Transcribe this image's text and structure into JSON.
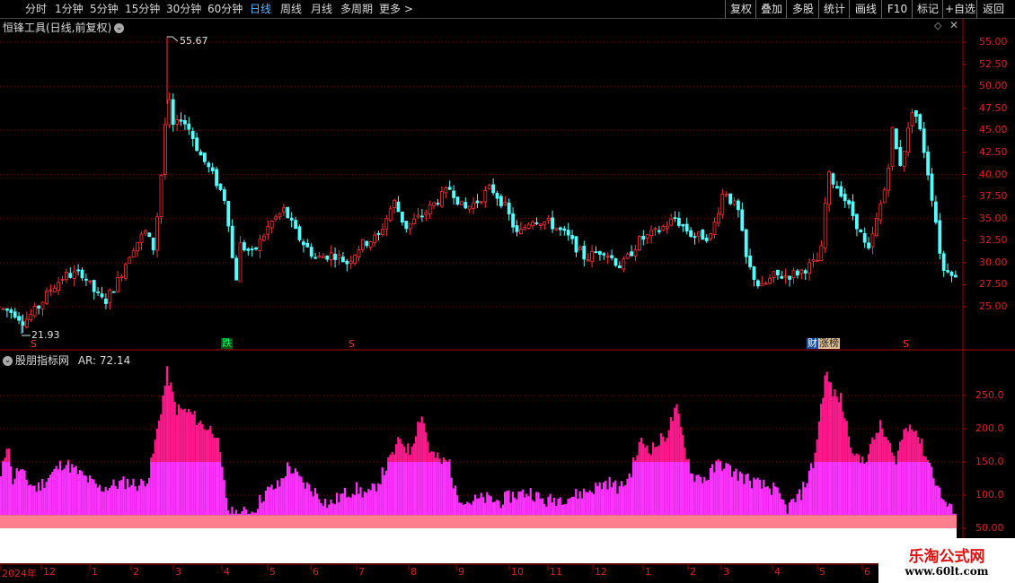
{
  "toolbar": {
    "periods": [
      "分时",
      "1分钟",
      "5分钟",
      "15分钟",
      "30分钟",
      "60分钟",
      "日线",
      "周线",
      "月线",
      "多周期",
      "更多 >"
    ],
    "active_period": "日线",
    "right_buttons": [
      "复权",
      "叠加",
      "多股",
      "统计",
      "画线",
      "F10",
      "标记",
      "+自选",
      "返回"
    ]
  },
  "main_chart": {
    "title": "恒锋工具(日线,前复权)",
    "high_label": "55.67",
    "low_label": "21.93",
    "y_ticks": [
      "55.00",
      "52.50",
      "50.00",
      "47.50",
      "45.00",
      "42.50",
      "40.00",
      "37.50",
      "35.00",
      "32.50",
      "30.00",
      "27.50",
      "25.00"
    ],
    "markers": [
      {
        "text": "S",
        "kind": "s",
        "pos": "x37"
      },
      {
        "text": "跌",
        "kind": "drop",
        "pos": "x249"
      },
      {
        "text": "S",
        "kind": "s",
        "pos": "x391"
      },
      {
        "text": "财",
        "kind": "fin",
        "pos": "x899"
      },
      {
        "text": "涨榜",
        "kind": "rise",
        "pos": "x911"
      },
      {
        "text": "S",
        "kind": "s",
        "pos": "x1008"
      }
    ],
    "colors": {
      "up": "#ff3232",
      "down": "#54ffff",
      "grid": "#8b0000",
      "axis": "#aa0000"
    }
  },
  "indicator": {
    "title": "股朋指标网",
    "value_label": "AR: 72.14",
    "y_ticks": [
      "250.0",
      "200.0",
      "150.0",
      "100.0",
      "50.00"
    ],
    "colors": {
      "high": "#ff1a8c",
      "mid": "#ff33ff",
      "base": "#ff7f8f",
      "floor": "#ffffff"
    }
  },
  "x_axis": {
    "labels": [
      "2024年",
      "12",
      "1",
      "2",
      "3",
      "4",
      "5",
      "6",
      "7",
      "8",
      "9",
      "10",
      "11",
      "12",
      "1",
      "2",
      "3",
      "4",
      "5",
      "6"
    ]
  },
  "watermark": {
    "title": "乐淘公式网",
    "url": "www.60lt.com"
  }
}
